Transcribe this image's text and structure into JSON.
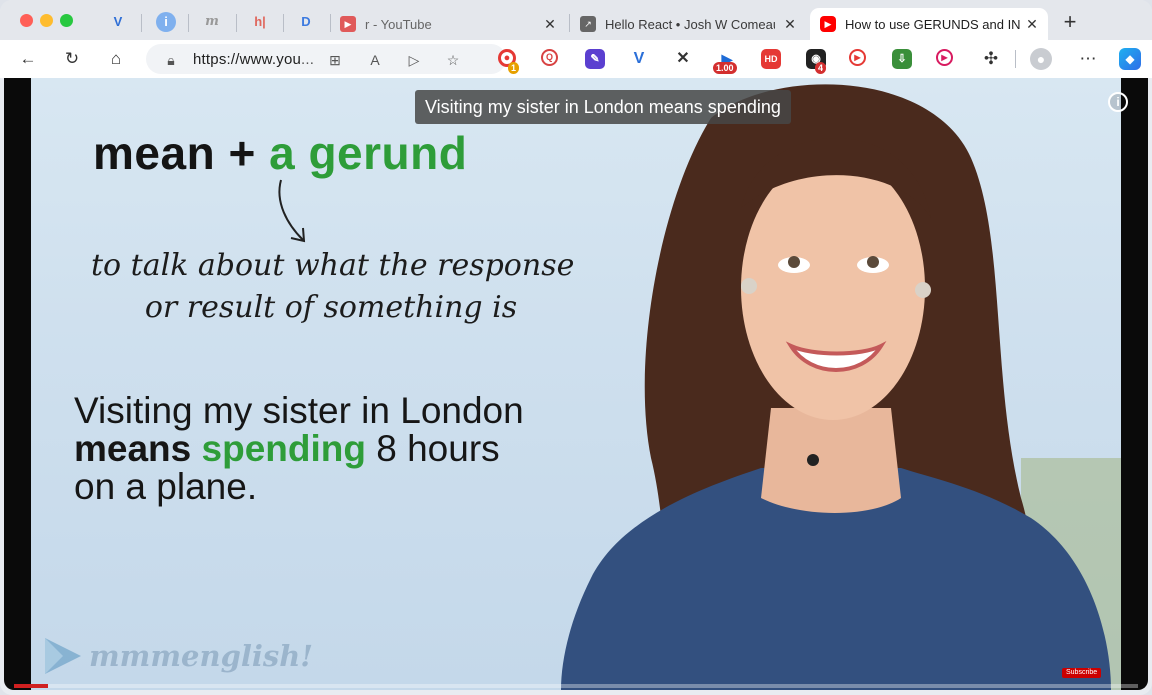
{
  "browser": {
    "pinned_tabs": [
      {
        "icon": "v-logo-icon",
        "color": "#2f6fd6",
        "glyph": "V"
      },
      {
        "icon": "info-circle-icon",
        "color": "#4a8fe6",
        "glyph": "i"
      },
      {
        "icon": "m-logo-icon",
        "color": "#8a8a8a",
        "glyph": "m"
      },
      {
        "icon": "h-logo-icon",
        "color": "#e0675d",
        "glyph": "h|"
      },
      {
        "icon": "d-logo-icon",
        "color": "#3d7be0",
        "glyph": "D"
      }
    ],
    "tabs": [
      {
        "title": "r - YouTube",
        "icon": "youtube-icon",
        "active": false
      },
      {
        "title": "Hello React • Josh W Comeau",
        "icon": "external-link-icon",
        "active": false
      },
      {
        "title": "How to use GERUNDS and INFINITIVES",
        "icon": "youtube-icon",
        "active": true
      }
    ],
    "url_main": "https://www.you",
    "url_ellipsis": "...",
    "extensions": [
      {
        "name": "record-extension-icon",
        "color": "#e53935",
        "badge": "1",
        "badge_color": "#e6a000"
      },
      {
        "name": "search-extension-icon",
        "color": "#d84343",
        "badge": "",
        "badge_color": ""
      },
      {
        "name": "pen-extension-icon",
        "color": "#5b3fd0",
        "badge": "",
        "badge_color": ""
      },
      {
        "name": "v-extension-icon",
        "color": "#2b6fd8",
        "badge": "",
        "badge_color": ""
      },
      {
        "name": "cross-extension-icon",
        "color": "#333333",
        "badge": "",
        "badge_color": ""
      },
      {
        "name": "speed-extension-icon",
        "color": "#1d6bd6",
        "badge": "1.00",
        "badge_color": "#d32f2f"
      },
      {
        "name": "hd-extension-icon",
        "color": "#e53935",
        "badge": "",
        "badge_color": ""
      },
      {
        "name": "game-extension-icon",
        "color": "#222222",
        "badge": "4",
        "badge_color": "#d32f2f"
      },
      {
        "name": "media-extension-icon",
        "color": "#e53935",
        "badge": "",
        "badge_color": ""
      },
      {
        "name": "download-extension-icon",
        "color": "#3a8f3a",
        "badge": "",
        "badge_color": ""
      },
      {
        "name": "play-extension-icon",
        "color": "#d81b60",
        "badge": "",
        "badge_color": ""
      }
    ],
    "speed_badge": "1.00",
    "hd_label": "HD"
  },
  "video": {
    "caption": "Visiting my sister in London means spending",
    "formula_lead": "mean + ",
    "formula_green": "a gerund",
    "note_line1": "to talk about what the response",
    "note_line2": "or result of something is",
    "example_line1": "Visiting my sister in London",
    "example_means": "means",
    "example_spending": "spending",
    "example_rest": " 8 hours",
    "example_line3": "on a plane.",
    "logo_text": "mmmenglish!",
    "subscribe_label": "Subscribe",
    "progress": 0.03
  }
}
